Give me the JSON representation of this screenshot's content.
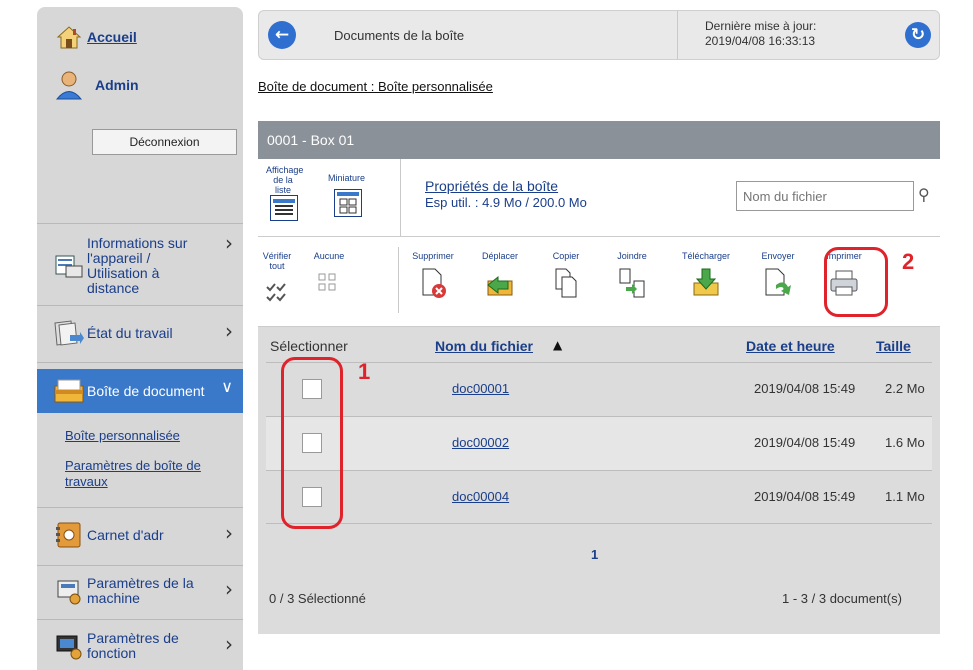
{
  "sidebar": {
    "home": "Accueil",
    "user": "Admin",
    "logout": "Déconnexion",
    "items": [
      {
        "label": "Informations sur l'appareil / Utilisation à distance",
        "icon": "device-info-icon"
      },
      {
        "label": "État du travail",
        "icon": "job-status-icon"
      },
      {
        "label": "Boîte de document",
        "icon": "document-box-icon"
      },
      {
        "label": "Carnet d'adr",
        "icon": "address-book-icon"
      },
      {
        "label": "Paramètres de la machine",
        "icon": "machine-settings-icon"
      },
      {
        "label": "Paramètres de fonction",
        "icon": "function-settings-icon"
      }
    ],
    "subitems": [
      "Boîte personnalisée",
      "Paramètres de boîte de travaux"
    ]
  },
  "header": {
    "title": "Documents de la boîte",
    "update_label": "Dernière mise à jour:",
    "update_time": "2019/04/08 16:33:13"
  },
  "breadcrumb": "Boîte de document : Boîte personnalisée",
  "box": {
    "name": "0001 - Box 01",
    "view_list": "Affichage de la liste",
    "view_thumb": "Miniature",
    "props_link": "Propriétés de la boîte",
    "props_usage": "Esp util. : 4.9 Mo / 200.0 Mo",
    "search_placeholder": "Nom du fichier"
  },
  "toolbar": {
    "check_all": "Vérifier tout",
    "none": "Aucune",
    "delete": "Supprimer",
    "move": "Déplacer",
    "copy": "Copier",
    "join": "Joindre",
    "download": "Télécharger",
    "send": "Envoyer",
    "print": "Imprimer"
  },
  "table": {
    "headers": {
      "select": "Sélectionner",
      "name": "Nom du fichier",
      "date": "Date et heure",
      "size": "Taille"
    },
    "rows": [
      {
        "name": "doc00001",
        "date": "2019/04/08 15:49",
        "size": "2.2 Mo"
      },
      {
        "name": "doc00002",
        "date": "2019/04/08 15:49",
        "size": "1.6 Mo"
      },
      {
        "name": "doc00004",
        "date": "2019/04/08 15:49",
        "size": "1.1 Mo"
      }
    ],
    "page": "1",
    "selected": "0 / 3 Sélectionné",
    "count": "1 - 3 / 3 document(s)"
  },
  "callouts": [
    "1",
    "2"
  ],
  "colors": {
    "accent": "#1a3e8a",
    "active": "#3a78c9",
    "callout": "#e0222a"
  }
}
